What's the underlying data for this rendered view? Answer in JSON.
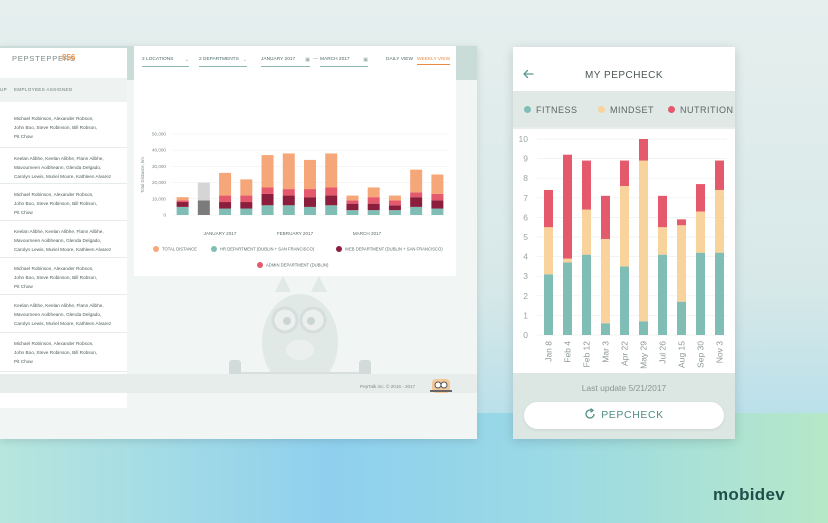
{
  "dashboard": {
    "pepsteppers_label": "PEPSTEPPERS",
    "pepsteppers_count": "856",
    "header_col1": "UP",
    "header_col2": "EMPLOYEES ASSIGNED",
    "employees": [
      [
        "Michael Robinson, Alexander Robson,",
        "John Boo, Steve Robinson, Bill Robson,",
        "Pit Chow"
      ],
      [
        "Keelan Alibhe, Keelan Alibhe, Flann Alibhe,",
        "Mavourneen Aoibheann, Glenda Delgado,",
        "Carolyn Lewis, Muriel Moore, Kathleen Alvarez"
      ],
      [
        "Michael Robinson, Alexander Robson,",
        "John Boo, Steve Robinson, Bill Robson,",
        "Pit Chow"
      ],
      [
        "Keelan Alibhe, Keelan Alibhe, Flann Alibhe,",
        "Mavourneen Aoibheann, Glenda Delgado,",
        "Carolyn Lewis, Muriel Moore, Kathleen Alvarez"
      ],
      [
        "Michael Robinson, Alexander Robson,",
        "John Boo, Steve Robinson, Bill Robson,",
        "Pit Chow"
      ],
      [
        "Keelan Alibhe, Keelan Alibhe, Flann Alibhe,",
        "Mavourneen Aoibheann, Glenda Delgado,",
        "Carolyn Lewis, Muriel Moore, Kathleen Alvarez"
      ],
      [
        "Michael Robinson, Alexander Robson,",
        "John Boo, Steve Robinson, Bill Robson,",
        "Pit Chow"
      ]
    ],
    "filters": {
      "locations": "2 LOCATIONS",
      "departments": "2 DEPARTMENTS",
      "date_from": "JANUARY 2017",
      "dash": "—",
      "date_to": "MARCH 2017",
      "daily_view": "DAILY VIEW",
      "weekly_view": "WEEKLY VIEW"
    },
    "copyright": "PepTalk inc. © 2016 - 2017"
  },
  "phone": {
    "title": "MY PEPCHECK",
    "legend": [
      "FITNESS",
      "MINDSET",
      "NUTRITION"
    ],
    "last_update": "Last update 5/21/2017",
    "button_label": "PEPCHECK"
  },
  "colors": {
    "fitness": "#7fbdb5",
    "mindset": "#f9d39c",
    "nutrition": "#e4596c",
    "total": "#f6a779",
    "hr": "#7fbdb5",
    "web": "#8b1d3d",
    "admin": "#e4596c"
  },
  "chart_data": [
    {
      "type": "bar",
      "title": "",
      "ylabel": "Total Distance, km",
      "ylim": [
        0,
        50000
      ],
      "yticks": [
        "0",
        "10,000",
        "20,000",
        "30,000",
        "40,000",
        "50,000"
      ],
      "xticks": [
        "JANUARY 2017",
        "FEBRUARY 2017",
        "MARCH 2017"
      ],
      "stacked": true,
      "series": [
        {
          "name": "TOTAL DISTANCE",
          "values": [
            2000,
            12000,
            14000,
            10000,
            20000,
            22000,
            18000,
            21000,
            3000,
            6000,
            3000,
            14000,
            12000
          ]
        },
        {
          "name": "HR DEPARTMENT (DUBLIN + SAN FRANCISCO)",
          "values": [
            5000,
            4000,
            4000,
            4000,
            6000,
            6000,
            5000,
            6000,
            3000,
            3000,
            3000,
            5000,
            4000
          ]
        },
        {
          "name": "WEB DEPARTMENT (DUBLIN + SAN FRANCISCO)",
          "values": [
            3000,
            0,
            4000,
            4000,
            7000,
            6000,
            6000,
            6000,
            4000,
            4000,
            3000,
            6000,
            5000
          ]
        },
        {
          "name": "ADMIN DEPARTMENT (DUBLIN)",
          "values": [
            1000,
            0,
            4000,
            4000,
            4000,
            4000,
            5000,
            5000,
            2000,
            4000,
            3000,
            3000,
            4000
          ]
        }
      ],
      "notes_gray_bar_index": 1,
      "gray_values": [
        9000,
        20000
      ]
    },
    {
      "type": "bar",
      "stacked": true,
      "ylim": [
        0,
        10
      ],
      "yticks": [
        "0",
        "1",
        "2",
        "3",
        "4",
        "5",
        "6",
        "7",
        "8",
        "9",
        "10"
      ],
      "categories": [
        "Jan 8",
        "Feb 4",
        "Feb 12",
        "Mar 3",
        "Apr 22",
        "May 29",
        "Jul 26",
        "Aug 15",
        "Sep 30",
        "Nov 3"
      ],
      "series": [
        {
          "name": "FITNESS",
          "values": [
            3.1,
            3.7,
            4.1,
            0.6,
            3.5,
            0.7,
            4.1,
            1.7,
            4.2,
            4.2
          ]
        },
        {
          "name": "MINDSET",
          "values": [
            2.4,
            0.2,
            2.3,
            4.3,
            4.1,
            8.2,
            1.4,
            3.9,
            2.1,
            3.2
          ]
        },
        {
          "name": "NUTRITION",
          "values": [
            1.9,
            5.3,
            2.5,
            2.2,
            1.3,
            1.1,
            1.6,
            0.3,
            1.4,
            1.5
          ]
        }
      ]
    }
  ],
  "brand": "mobidev"
}
